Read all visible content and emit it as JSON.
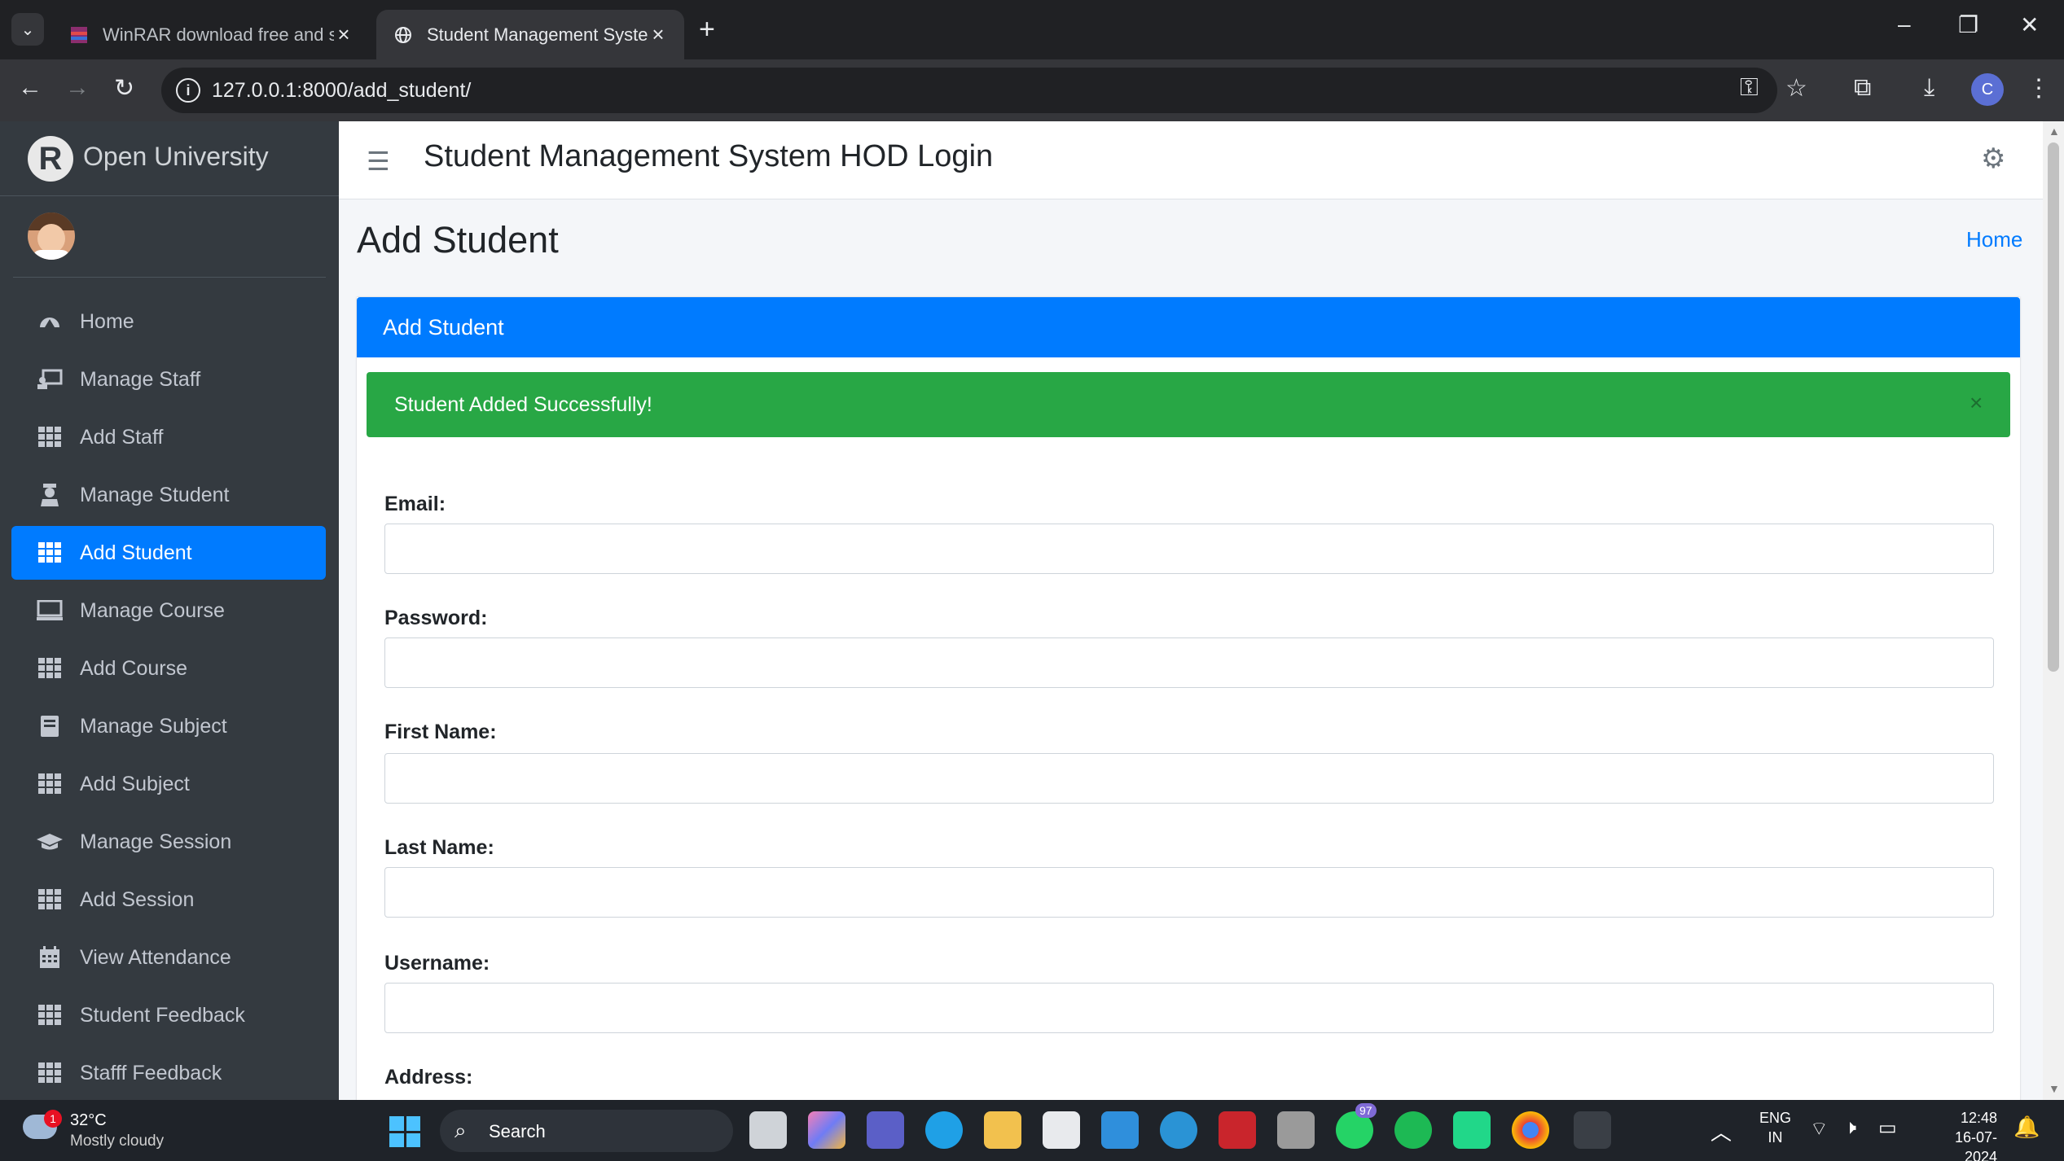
{
  "browser": {
    "tabs": [
      {
        "title": "WinRAR download free and sup",
        "active": false
      },
      {
        "title": "Student Management System |",
        "active": true
      }
    ],
    "new_tab_label": "+",
    "url": "127.0.0.1:8000/add_student/",
    "profile_initial": "C",
    "colors": {
      "frame": "#202124",
      "toolbar": "#35363a"
    }
  },
  "sidebar": {
    "brand": "Open University",
    "brand_logo_letter": "R",
    "items": [
      {
        "label": "Home",
        "icon": "dashboard-icon",
        "active": false
      },
      {
        "label": "Manage Staff",
        "icon": "staff-icon",
        "active": false
      },
      {
        "label": "Add Staff",
        "icon": "grid-icon",
        "active": false
      },
      {
        "label": "Manage Student",
        "icon": "student-icon",
        "active": false
      },
      {
        "label": "Add Student",
        "icon": "grid-icon",
        "active": true
      },
      {
        "label": "Manage Course",
        "icon": "monitor-icon",
        "active": false
      },
      {
        "label": "Add Course",
        "icon": "grid-icon",
        "active": false
      },
      {
        "label": "Manage Subject",
        "icon": "book-icon",
        "active": false
      },
      {
        "label": "Add Subject",
        "icon": "grid-icon",
        "active": false
      },
      {
        "label": "Manage Session",
        "icon": "graduation-cap-icon",
        "active": false
      },
      {
        "label": "Add Session",
        "icon": "grid-icon",
        "active": false
      },
      {
        "label": "View Attendance",
        "icon": "calendar-icon",
        "active": false
      },
      {
        "label": "Student Feedback",
        "icon": "grid-icon",
        "active": false
      },
      {
        "label": "Stafff Feedback",
        "icon": "grid-icon",
        "active": false
      }
    ],
    "colors": {
      "background": "#343a40",
      "active": "#007bff",
      "text": "#c2c7d0"
    }
  },
  "header": {
    "title": "Student Management System HOD Login"
  },
  "page": {
    "title": "Add Student",
    "breadcrumb": "Home"
  },
  "card": {
    "title": "Add Student",
    "alert": "Student Added Successfully!",
    "alert_close": "×",
    "fields": [
      {
        "label": "Email:",
        "value": "",
        "placeholder": ""
      },
      {
        "label": "Password:",
        "value": "",
        "placeholder": ""
      },
      {
        "label": "First Name:",
        "value": "",
        "placeholder": ""
      },
      {
        "label": "Last Name:",
        "value": "",
        "placeholder": ""
      },
      {
        "label": "Username:",
        "value": "",
        "placeholder": ""
      },
      {
        "label": "Address:",
        "value": "",
        "placeholder": ""
      }
    ],
    "colors": {
      "header": "#007bff",
      "success": "#28a745"
    }
  },
  "taskbar": {
    "weather_temp": "32°C",
    "weather_condition": "Mostly cloudy",
    "weather_badge": "1",
    "search_label": "Search",
    "whatsapp_badge": "97",
    "language_line1": "ENG",
    "language_line2": "IN",
    "time": "12:48",
    "date": "16-07-2024"
  }
}
